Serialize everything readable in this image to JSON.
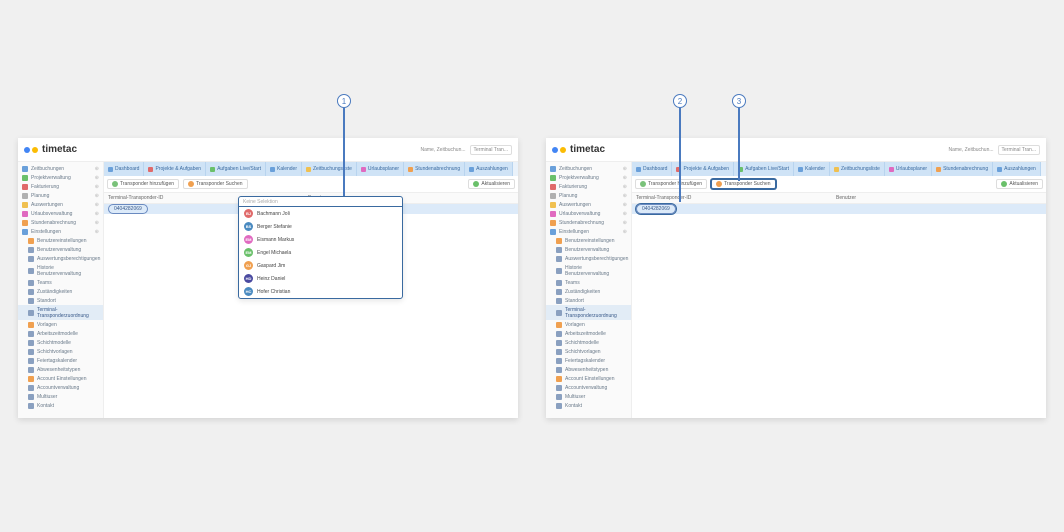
{
  "logo_text": "timetac",
  "topright": {
    "name_label": "Name, Zeitbuchun...",
    "button_label": "Terminal Tran..."
  },
  "tabs": [
    {
      "label": "Dashboard",
      "color": "#6aa0da"
    },
    {
      "label": "Projekte & Aufgaben",
      "color": "#e06a6a"
    },
    {
      "label": "Aufgaben Live/Start",
      "color": "#6ac06a"
    },
    {
      "label": "Kalender",
      "color": "#6aa0da"
    },
    {
      "label": "Zeitbuchungsliste",
      "color": "#f0c050"
    },
    {
      "label": "Urlaubsplaner",
      "color": "#e06ac0"
    },
    {
      "label": "Stundenabrechnung",
      "color": "#f0a050"
    },
    {
      "label": "Auszahlungen",
      "color": "#6aa0da"
    }
  ],
  "toolbar": {
    "add": "Transponder hinzufügen",
    "search": "Transponder Suchen",
    "refresh": "Aktualisieren"
  },
  "columns": {
    "c1": "Terminal-Transponder-ID",
    "c2": "Benutzer"
  },
  "chip_value": "0404282069",
  "sidebar_main": [
    {
      "label": "Zeitbuchungen",
      "color": "#6aa0da"
    },
    {
      "label": "Projektverwaltung",
      "color": "#6ac06a"
    },
    {
      "label": "Fakturierung",
      "color": "#e06a6a"
    },
    {
      "label": "Planung",
      "color": "#b0b0b0"
    },
    {
      "label": "Auswertungen",
      "color": "#f0c050"
    },
    {
      "label": "Urlaubsverwaltung",
      "color": "#e06ac0"
    },
    {
      "label": "Stundenabrechnung",
      "color": "#f0a050"
    },
    {
      "label": "Einstellungen",
      "color": "#6aa0da",
      "expanded": true
    }
  ],
  "sidebar_settings": [
    {
      "label": "Benutzereinstellungen",
      "folder": true
    },
    {
      "label": "Benutzerverwaltung"
    },
    {
      "label": "Auswertungsberechtigungen"
    },
    {
      "label": "Historie Benutzerverwaltung"
    },
    {
      "label": "Teams"
    },
    {
      "label": "Zuständigkeiten"
    },
    {
      "label": "Standort"
    },
    {
      "label": "Terminal-Transponderzuordnung",
      "active": true
    },
    {
      "label": "Vorlagen",
      "folder": true
    },
    {
      "label": "Arbeitszeitmodelle"
    },
    {
      "label": "Schichtmodelle"
    },
    {
      "label": "Schichtvorlagen"
    },
    {
      "label": "Feiertagskalender"
    },
    {
      "label": "Abwesenheitstypen"
    },
    {
      "label": "Account Einstellungen",
      "folder": true
    },
    {
      "label": "Accountverwaltung"
    },
    {
      "label": "Multiuser"
    },
    {
      "label": "Kontakt"
    }
  ],
  "dropdown": {
    "placeholder": "Keine Selektion",
    "items": [
      {
        "initials": "BJ",
        "name": "Bachmann Joli",
        "color": "#e06a6a"
      },
      {
        "initials": "BS",
        "name": "Berger Stefanie",
        "color": "#4a8ac0"
      },
      {
        "initials": "EM",
        "name": "Eismann Markus",
        "color": "#e06ac0"
      },
      {
        "initials": "EM",
        "name": "Engel Michaela",
        "color": "#6ac06a"
      },
      {
        "initials": "GJ",
        "name": "Gaspard Jim",
        "color": "#f0a050"
      },
      {
        "initials": "HD",
        "name": "Heinz Daniel",
        "color": "#4a4aa0"
      },
      {
        "initials": "HC",
        "name": "Hofer Christian",
        "color": "#4a8ac0"
      }
    ]
  },
  "callouts": {
    "c1": "1",
    "c2": "2",
    "c3": "3"
  }
}
